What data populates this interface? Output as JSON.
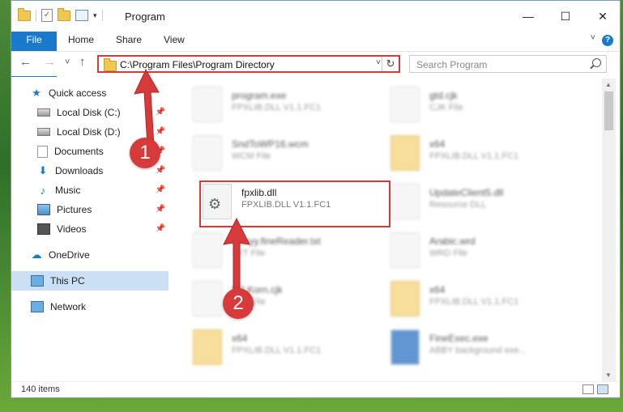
{
  "window": {
    "title": "Program",
    "controls": {
      "minimize": "—",
      "maximize": "☐",
      "close": "✕"
    }
  },
  "ribbon": {
    "tabs": [
      "File",
      "Home",
      "Share",
      "View"
    ],
    "help": "?"
  },
  "nav": {
    "back": "←",
    "forward": "→",
    "recent": "˅",
    "up": "↑",
    "address": "C:\\Program Files\\Program Directory",
    "search_placeholder": "Search Program"
  },
  "sidebar": {
    "items": [
      {
        "label": "Quick access"
      },
      {
        "label": "Local Disk (C:)"
      },
      {
        "label": "Local Disk (D:)"
      },
      {
        "label": "Documents"
      },
      {
        "label": "Downloads"
      },
      {
        "label": "Music"
      },
      {
        "label": "Pictures"
      },
      {
        "label": "Videos"
      },
      {
        "label": "OneDrive"
      },
      {
        "label": "This PC"
      },
      {
        "label": "Network"
      }
    ]
  },
  "files": [
    {
      "name": "program.exe",
      "type": "FPXLIB.DLL V1.1.FC1"
    },
    {
      "name": "gtd.cjk",
      "type": "CJK File"
    },
    {
      "name": "SndToWP16.wcm",
      "type": "WCM File"
    },
    {
      "name": "x64",
      "type": "FPXLIB.DLL V1.1.FC1"
    },
    {
      "name": "fpxlib.dll",
      "type": "FPXLIB.DLL V1.1.FC1"
    },
    {
      "name": "UpdateClient5.dll",
      "type": "Resource DLL"
    },
    {
      "name": "Abbyy.fineReader.txt",
      "type": "TXT File"
    },
    {
      "name": "Arabic.wrd",
      "type": "WRD File"
    },
    {
      "name": "FR.Korn.cjk",
      "type": "CJK File"
    },
    {
      "name": "x64",
      "type": "FPXLIB.DLL V1.1.FC1"
    },
    {
      "name": "x64",
      "type": "FPXLIB.DLL V1.1.FC1"
    },
    {
      "name": "FineExec.exe",
      "type": "ABBY background exe..."
    }
  ],
  "status": {
    "count": "140 items"
  },
  "annotations": {
    "step1": "1",
    "step2": "2"
  },
  "colors": {
    "accent": "#1979ca",
    "highlight": "#d63a3a",
    "selected": "#cce0f5"
  }
}
